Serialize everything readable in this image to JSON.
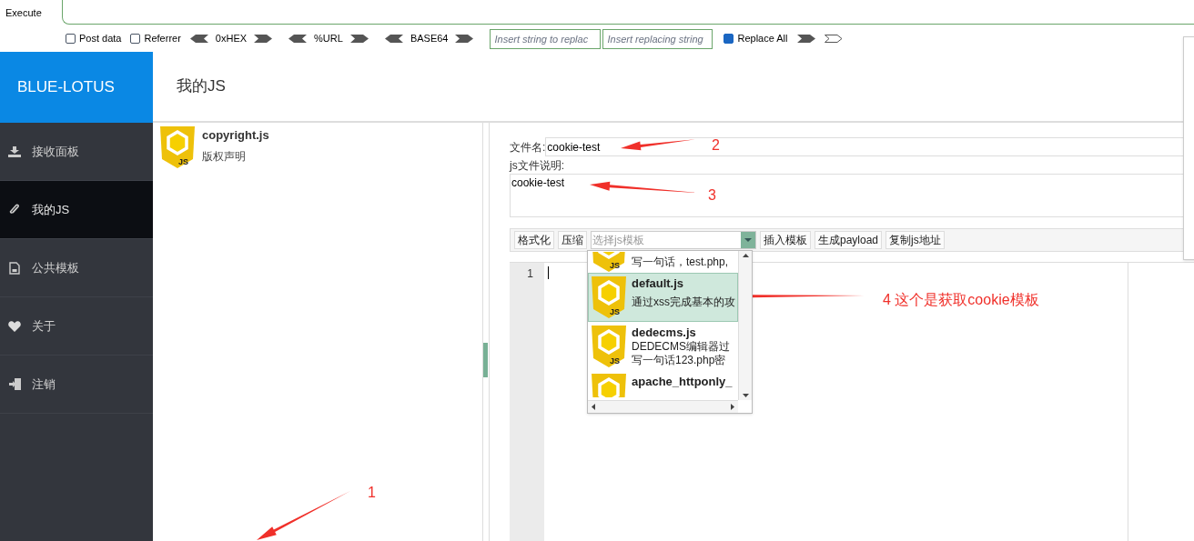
{
  "execute_tab": {
    "label": "Execute"
  },
  "hackbar": {
    "checkboxes": [
      {
        "label": "Post data",
        "checked": false
      },
      {
        "label": "Referrer",
        "checked": false
      }
    ],
    "encoders": [
      "0xHEX",
      "%URL",
      "BASE64"
    ],
    "replace_fields": [
      {
        "placeholder": "Insert string to replac"
      },
      {
        "placeholder": "Insert replacing string"
      }
    ],
    "replace_all": {
      "label": "Replace All",
      "checked": true
    }
  },
  "sidebar": {
    "brand": "BLUE-LOTUS",
    "items": [
      {
        "kind": "download",
        "label": "接收面板",
        "selected": false
      },
      {
        "kind": "paperclip",
        "label": "我的JS",
        "selected": true
      },
      {
        "kind": "file",
        "label": "公共模板",
        "selected": false
      },
      {
        "kind": "heart",
        "label": "关于",
        "selected": false
      },
      {
        "kind": "logout",
        "label": "注销",
        "selected": false
      }
    ]
  },
  "header": {
    "title": "我的JS"
  },
  "js_list": [
    {
      "name": "copyright.js",
      "description": "版权声明",
      "icon_text": "JS"
    }
  ],
  "form": {
    "filename_label": "文件名:",
    "filename": "cookie-test",
    "description_label": "js文件说明:",
    "description": "cookie-test"
  },
  "editor_toolbar": {
    "buttons_left": [
      "格式化",
      "压缩"
    ],
    "template_select": {
      "placeholder": "选择js模板"
    },
    "buttons_right": [
      "插入模板",
      "生成payload",
      "复制js地址"
    ]
  },
  "template_dropdown": [
    {
      "lines": [
        "写一句话，test.php,"
      ],
      "icon_text": "JS",
      "selected": false
    },
    {
      "name": "default.js",
      "lines": [
        "通过xss完成基本的攻"
      ],
      "icon_text": "JS",
      "selected": true
    },
    {
      "name": "dedecms.js",
      "lines": [
        "DEDECMS编辑器过",
        "写一句话123.php密"
      ],
      "icon_text": "JS",
      "selected": false
    },
    {
      "name": "apache_httponly_",
      "selected": false
    }
  ],
  "editor": {
    "line_numbers": [
      "1"
    ]
  },
  "annotations": [
    {
      "label": "1"
    },
    {
      "label": "2"
    },
    {
      "label": "3"
    },
    {
      "label": "4 这个是获取cookie模板"
    }
  ]
}
